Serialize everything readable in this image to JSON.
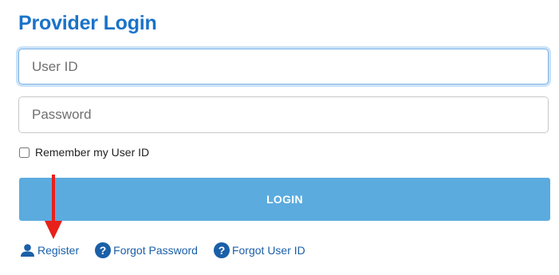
{
  "header": {
    "title": "Provider Login"
  },
  "form": {
    "user_id_placeholder": "User ID",
    "password_placeholder": "Password",
    "remember_label": "Remember my User ID",
    "remember_checked": false,
    "login_label": "LOGIN"
  },
  "links": {
    "register": "Register",
    "forgot_password": "Forgot Password",
    "forgot_user_id": "Forgot User ID"
  },
  "icons": {
    "register": "user-icon",
    "forgot_password": "question-circle-icon",
    "forgot_user_id": "question-circle-icon",
    "annotation": "red-arrow-down"
  },
  "colors": {
    "title": "#1a73c8",
    "login_button": "#5babdf",
    "link": "#1a5fa8",
    "annotation_arrow": "#e8201a"
  }
}
